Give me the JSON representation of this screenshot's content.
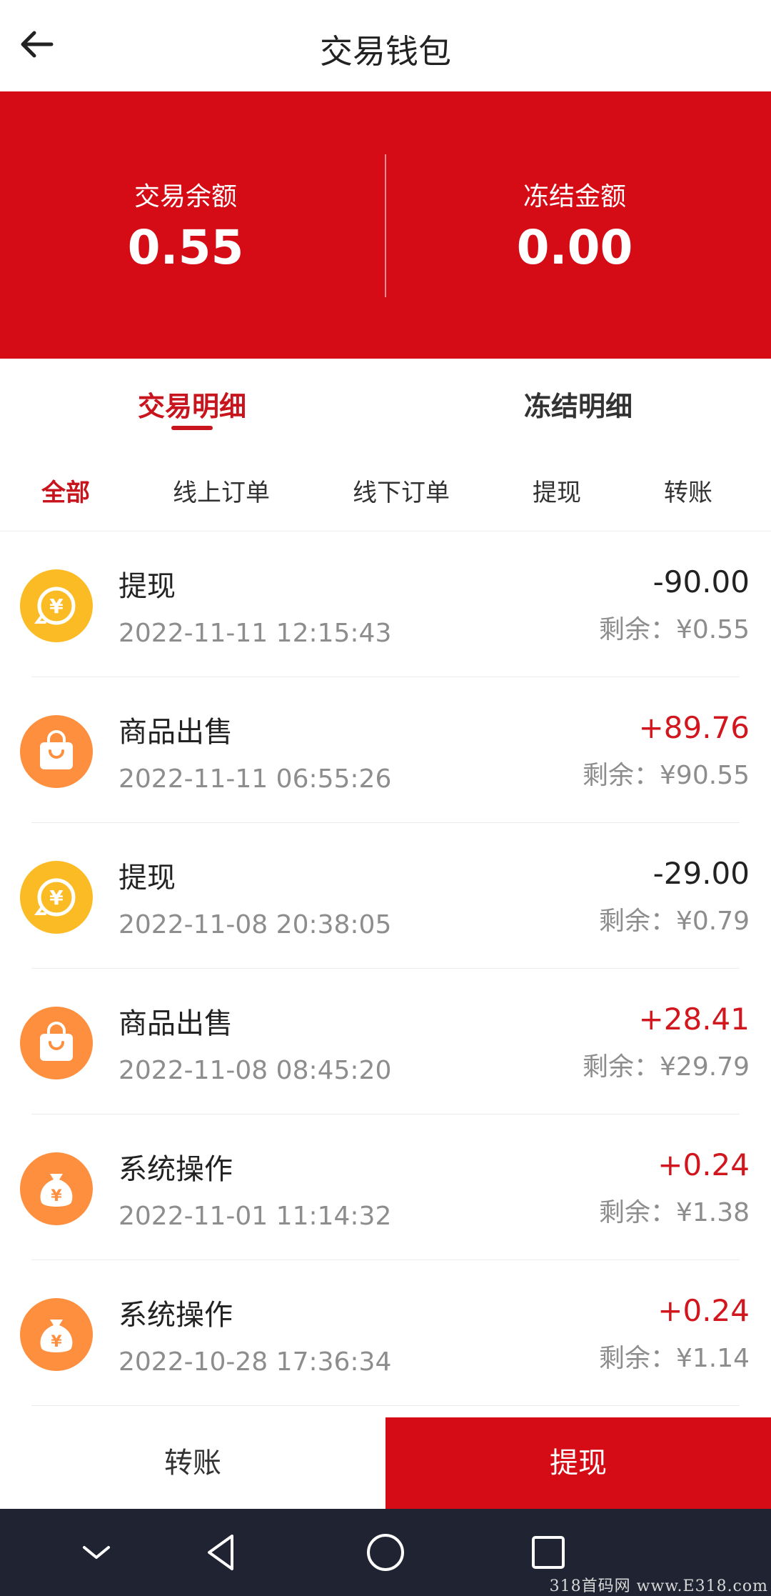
{
  "header": {
    "title": "交易钱包"
  },
  "balances": {
    "trade_label": "交易余额",
    "trade_value": "0.55",
    "frozen_label": "冻结金额",
    "frozen_value": "0.00"
  },
  "tabs": [
    {
      "label": "交易明细",
      "active": true
    },
    {
      "label": "冻结明细",
      "active": false
    }
  ],
  "filters": [
    {
      "label": "全部",
      "active": true
    },
    {
      "label": "线上订单",
      "active": false
    },
    {
      "label": "线下订单",
      "active": false
    },
    {
      "label": "提现",
      "active": false
    },
    {
      "label": "转账",
      "active": false
    }
  ],
  "transactions": [
    {
      "icon": "withdraw-icon",
      "title": "提现",
      "time": "2022-11-11 12:15:43",
      "amount": "-90.00",
      "remaining": "剩余：¥0.55"
    },
    {
      "icon": "shopping-bag-icon",
      "title": "商品出售",
      "time": "2022-11-11 06:55:26",
      "amount": "+89.76",
      "remaining": "剩余：¥90.55"
    },
    {
      "icon": "withdraw-icon",
      "title": "提现",
      "time": "2022-11-08 20:38:05",
      "amount": "-29.00",
      "remaining": "剩余：¥0.79"
    },
    {
      "icon": "shopping-bag-icon",
      "title": "商品出售",
      "time": "2022-11-08 08:45:20",
      "amount": "+28.41",
      "remaining": "剩余：¥29.79"
    },
    {
      "icon": "money-bag-icon",
      "title": "系统操作",
      "time": "2022-11-01 11:14:32",
      "amount": "+0.24",
      "remaining": "剩余：¥1.38"
    },
    {
      "icon": "money-bag-icon",
      "title": "系统操作",
      "time": "2022-10-28 17:36:34",
      "amount": "+0.24",
      "remaining": "剩余：¥1.14"
    }
  ],
  "actions": {
    "transfer_label": "转账",
    "withdraw_label": "提现"
  },
  "watermark": "318首码网 www.E318.com",
  "colors": {
    "brand_red": "#d50b15",
    "positive_red": "#d1161e",
    "icon_yellow": "#fbbb24",
    "icon_orange": "#fd8f3e",
    "navbar": "#1f2332"
  }
}
